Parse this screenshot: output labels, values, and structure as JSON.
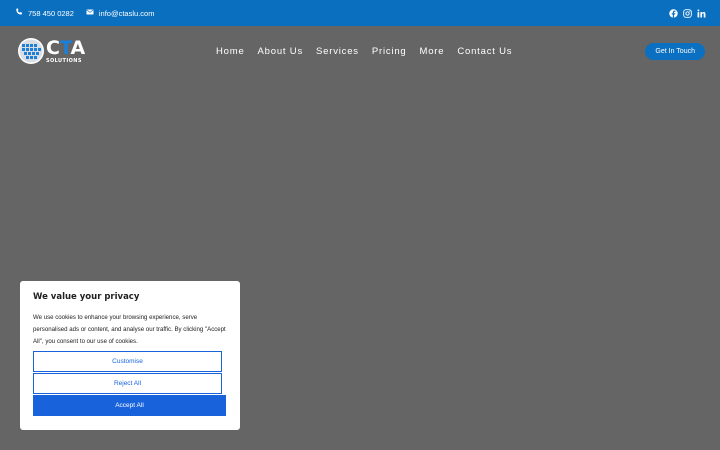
{
  "colors": {
    "topbar_bg": "#0a6fbf",
    "page_bg": "#656565",
    "accent": "#1863dc",
    "cta_bg": "#0b6fc2"
  },
  "topbar": {
    "phone": {
      "icon": "phone-icon",
      "text": "758 450 0282"
    },
    "email": {
      "icon": "mail-icon",
      "text": "info@ctaslu.com"
    },
    "social": [
      {
        "icon": "facebook-icon"
      },
      {
        "icon": "instagram-icon"
      },
      {
        "icon": "linkedin-icon"
      }
    ]
  },
  "logo": {
    "mark_left": "C",
    "mark_mid": "T",
    "mark_right": "A",
    "sub": "SOLUTIONS"
  },
  "nav": {
    "items": [
      {
        "label": "Home"
      },
      {
        "label": "About Us"
      },
      {
        "label": "Services"
      },
      {
        "label": "Pricing"
      },
      {
        "label": "More"
      },
      {
        "label": "Contact Us"
      }
    ],
    "cta_label": "Get In Touch"
  },
  "cookie": {
    "title": "We value your privacy",
    "body": "We use cookies to enhance your browsing experience, serve personalised ads or content, and analyse our traffic. By clicking \"Accept All\", you consent to our use of cookies.",
    "customise_label": "Customise",
    "reject_label": "Reject All",
    "accept_label": "Accept All"
  }
}
